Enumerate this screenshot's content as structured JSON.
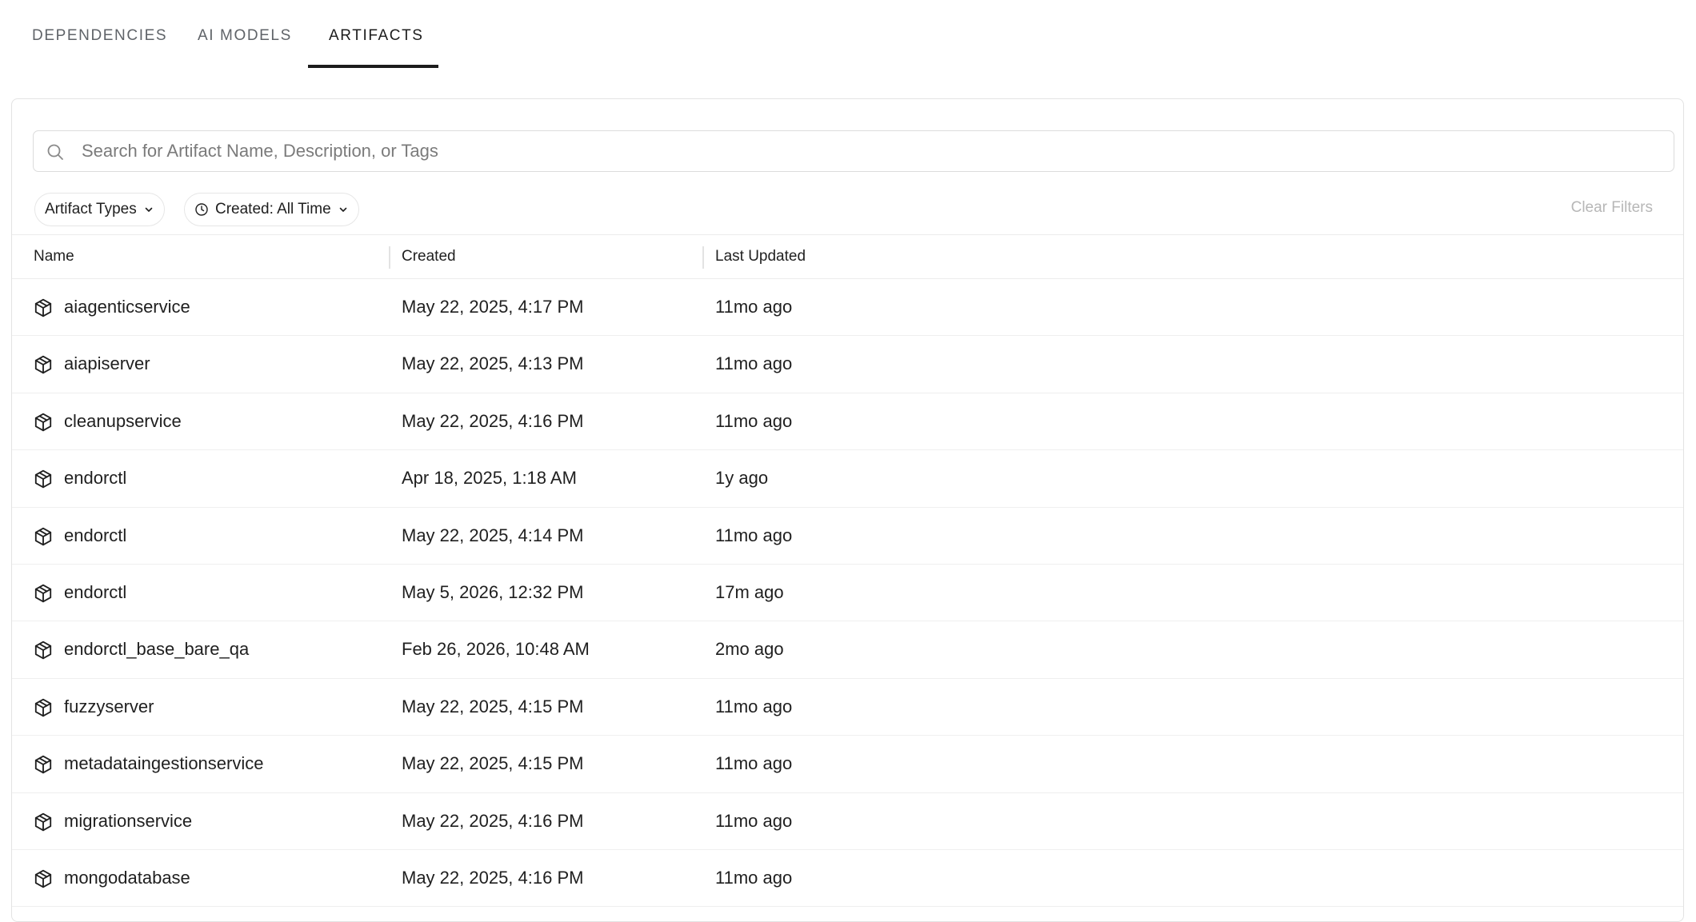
{
  "tabs": [
    {
      "label": "DEPENDENCIES",
      "active": false
    },
    {
      "label": "AI MODELS",
      "active": false
    },
    {
      "label": "ARTIFACTS",
      "active": true
    }
  ],
  "search": {
    "placeholder": "Search for Artifact Name, Description, or Tags",
    "value": ""
  },
  "filters": {
    "artifact_types_label": "Artifact Types",
    "created_label": "Created: All Time",
    "clear_label": "Clear Filters"
  },
  "table": {
    "columns": [
      "Name",
      "Created",
      "Last Updated"
    ],
    "rows": [
      {
        "icon": "package-icon",
        "name": "aiagenticservice",
        "created": "May 22, 2025, 4:17 PM",
        "updated": "11mo ago"
      },
      {
        "icon": "package-icon",
        "name": "aiapiserver",
        "created": "May 22, 2025, 4:13 PM",
        "updated": "11mo ago"
      },
      {
        "icon": "package-icon",
        "name": "cleanupservice",
        "created": "May 22, 2025, 4:16 PM",
        "updated": "11mo ago"
      },
      {
        "icon": "package-icon",
        "name": "endorctl",
        "created": "Apr 18, 2025, 1:18 AM",
        "updated": "1y ago"
      },
      {
        "icon": "package-icon",
        "name": "endorctl",
        "created": "May 22, 2025, 4:14 PM",
        "updated": "11mo ago"
      },
      {
        "icon": "package-icon",
        "name": "endorctl",
        "created": "May 5, 2026, 12:32 PM",
        "updated": "17m ago"
      },
      {
        "icon": "package-icon",
        "name": "endorctl_base_bare_qa",
        "created": "Feb 26, 2026, 10:48 AM",
        "updated": "2mo ago"
      },
      {
        "icon": "package-icon",
        "name": "fuzzyserver",
        "created": "May 22, 2025, 4:15 PM",
        "updated": "11mo ago"
      },
      {
        "icon": "package-icon",
        "name": "metadataingestionservice",
        "created": "May 22, 2025, 4:15 PM",
        "updated": "11mo ago"
      },
      {
        "icon": "package-icon",
        "name": "migrationservice",
        "created": "May 22, 2025, 4:16 PM",
        "updated": "11mo ago"
      },
      {
        "icon": "package-icon",
        "name": "mongodatabase",
        "created": "May 22, 2025, 4:16 PM",
        "updated": "11mo ago"
      }
    ]
  },
  "colors": {
    "text": "#1f1f1f",
    "muted": "#5f6368",
    "border": "#e3e3e3",
    "disabled": "#b7b7b7"
  }
}
